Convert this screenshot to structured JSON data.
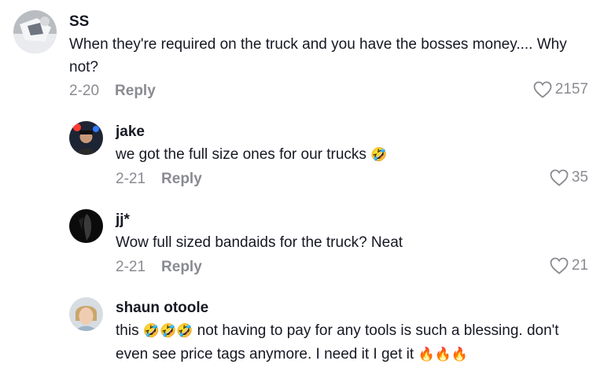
{
  "comments": [
    {
      "username": "SS",
      "text": "When they're required on the truck and you have the bosses money.... Why not?",
      "date": "2-20",
      "reply_label": "Reply",
      "likes": "2157",
      "avatar_icon": "avatar-photo-icon"
    },
    {
      "username": "jake",
      "text_before": "we got the full size ones for our trucks",
      "emoji": "🤣",
      "date": "2-21",
      "reply_label": "Reply",
      "likes": "35",
      "avatar_icon": "avatar-photo-icon"
    },
    {
      "username": "jj*",
      "text": "Wow full sized bandaids for the truck? Neat",
      "date": "2-21",
      "reply_label": "Reply",
      "likes": "21",
      "avatar_icon": "avatar-photo-icon"
    },
    {
      "username": "shaun otoole",
      "text_prefix": "this",
      "emoji_prefix": "🤣🤣🤣",
      "text_middle": "not having to pay for any tools is such a blessing. don't even see price tags anymore. I need it I get it",
      "emoji_suffix": "🔥🔥🔥",
      "avatar_icon": "avatar-photo-icon"
    }
  ],
  "colors": {
    "text": "#161823",
    "muted": "#8a8b91",
    "background": "#ffffff"
  },
  "icons": {
    "like": "heart-outline-icon"
  }
}
